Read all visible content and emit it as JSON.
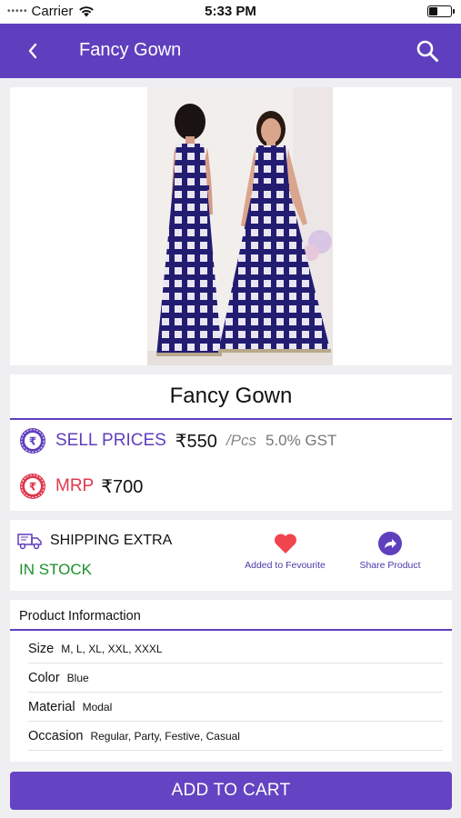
{
  "status_bar": {
    "carrier": "Carrier",
    "time": "5:33 PM"
  },
  "header": {
    "title": "Fancy Gown"
  },
  "product": {
    "name": "Fancy Gown",
    "sell_label": "SELL PRICES",
    "sell_price": "₹550",
    "unit": "/Pcs",
    "gst": "5.0% GST",
    "mrp_label": "MRP",
    "mrp_price": "₹700",
    "image_description": "Two models wearing a sleeveless navy blue check-pattern flared gown"
  },
  "shipping": {
    "shipping_text": "SHIPPING EXTRA",
    "stock_text": "IN STOCK",
    "favourite_label": "Added to Fevourite",
    "share_label": "Share Product"
  },
  "info": {
    "header": "Product Informaction",
    "rows": [
      {
        "key": "Size",
        "value": "M, L, XL, XXL, XXXL"
      },
      {
        "key": "Color",
        "value": "Blue"
      },
      {
        "key": "Material",
        "value": "Modal"
      },
      {
        "key": "Occasion",
        "value": "Regular, Party, Festive, Casual"
      }
    ]
  },
  "cart_button": {
    "label": "ADD TO CART"
  },
  "colors": {
    "primary": "#5f3fbd",
    "mrp": "#e0374c",
    "stock": "#1d8f2c",
    "heart": "#f0454f",
    "gown": "#1f1a6e"
  },
  "icons": {
    "back": "chevron-left-icon",
    "search": "search-icon",
    "sell_price": "rupee-coin-icon",
    "mrp": "rupee-coin-icon",
    "shipping": "delivery-truck-icon",
    "favourite": "heart-icon",
    "share": "share-arrow-icon"
  }
}
